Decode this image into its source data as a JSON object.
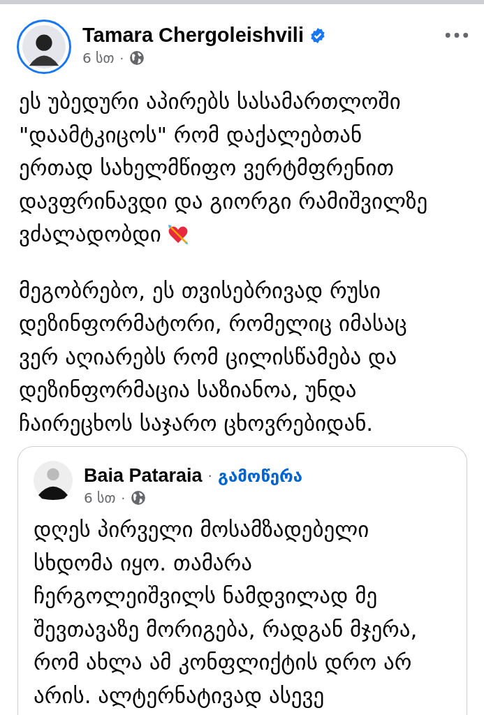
{
  "post": {
    "author": "Tamara Chergoleishvili",
    "verified": true,
    "time": "6 სთ",
    "meta_separator": "·",
    "paragraphs": [
      "ეს უბედური აპირებს სასამართლოში\n\"დაამტკიცოს\" რომ დაქალებთან\nერთად სახელმწიფო ვერტმფრენით\nდავფრინავდი და გიორგი რამიშვილზე\nვძალადობდი",
      "მეგობრებო, ეს  თვისებრივად რუსი\nდეზინფორმატორი, რომელიც იმასაც\nვერ აღიარებს რომ ცილისწამება და\nდეზინფორმაცია საზიანოა, უნდა\nჩაირეცხოს საჯარო ცხოვრებიდან."
    ],
    "shared": {
      "author": "Baia Pataraia",
      "separator": "·",
      "follow": "გამოწერა",
      "time": "6 სთ",
      "meta_separator": "·",
      "text": "დღეს პირველი მოსამზადებელი\nსხდომა იყო. თამარა\nჩერგოლეიშვილს ნამდვილად მე\nშევთავაზე მორიგება, რადგან მჯერა,\nრომ ახლა ამ კონფლიქტის დრო არ\nარის. ალტერნატივად ასევე"
    }
  }
}
